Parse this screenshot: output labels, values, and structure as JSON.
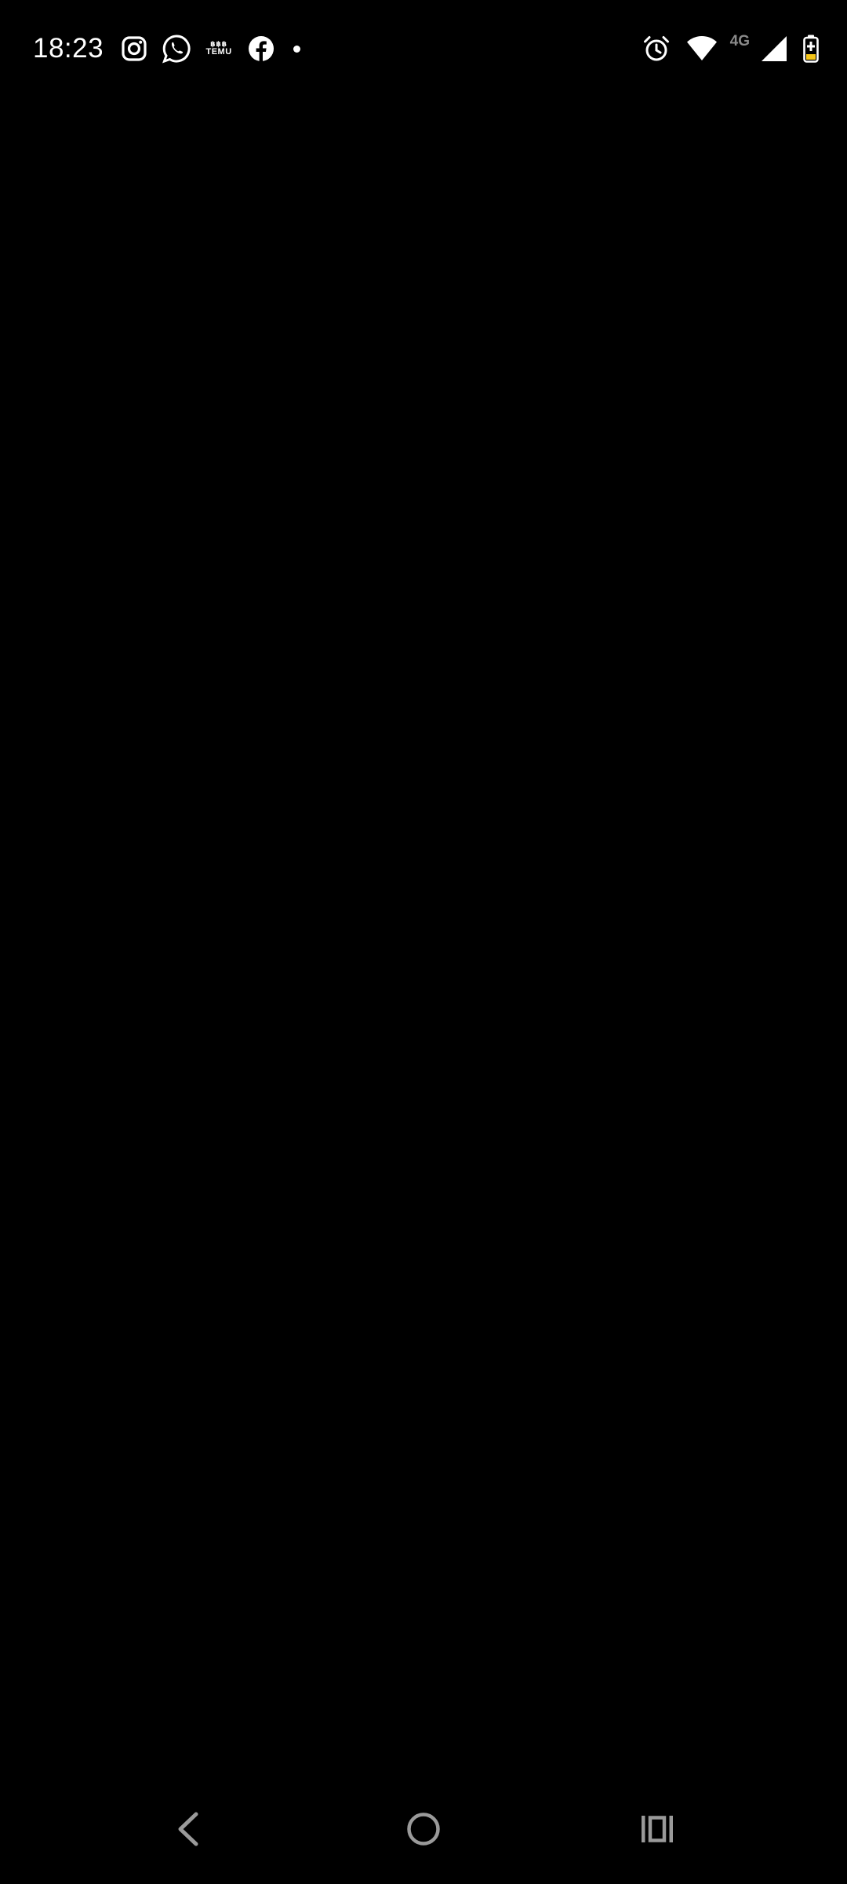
{
  "status_bar": {
    "time": "18:23",
    "notification_icons": [
      "instagram-icon",
      "whatsapp-icon",
      "temu-icon",
      "facebook-icon",
      "more-notifications-dot"
    ],
    "temu_label_top": "฿฿฿",
    "temu_label_bottom": "TEMU",
    "network_type": "4G",
    "system_icons": [
      "alarm-icon",
      "wifi-icon",
      "cellular-signal-icon",
      "battery-charging-icon"
    ],
    "battery_color": "#f5c518"
  },
  "nav_bar": {
    "buttons": [
      "back-button",
      "home-button",
      "recents-button"
    ],
    "icon_color": "#9a9a9a"
  },
  "colors": {
    "background": "#000000",
    "status_text": "#ffffff"
  }
}
